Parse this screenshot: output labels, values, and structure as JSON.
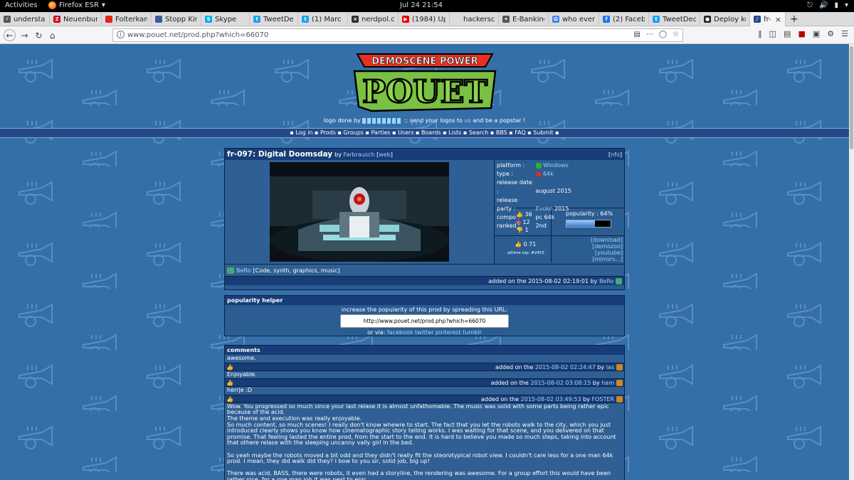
{
  "gnome": {
    "activities": "Activities",
    "app": "Firefox ESR",
    "clock": "Jul 24  21:54"
  },
  "tabs": [
    {
      "label": "understan",
      "color": "#555",
      "glyph": "⚡"
    },
    {
      "label": "Neuenburg",
      "color": "#d0021b",
      "glyph": "Z"
    },
    {
      "label": "Folterkam",
      "color": "#e1251b",
      "glyph": ""
    },
    {
      "label": "Stopp Kind",
      "color": "#3b5aa0",
      "glyph": ""
    },
    {
      "label": "Skype",
      "color": "#00aff0",
      "glyph": "S"
    },
    {
      "label": "TweetDec",
      "color": "#1da1f2",
      "glyph": "t"
    },
    {
      "label": "(1) Marc [L",
      "color": "#1da1f2",
      "glyph": "t"
    },
    {
      "label": "nerdpol.ch",
      "color": "#333",
      "glyph": "×"
    },
    {
      "label": "(1984) Upl",
      "color": "#e00",
      "glyph": "▶"
    },
    {
      "label": "hackerscardg",
      "color": "#ddd",
      "glyph": ""
    },
    {
      "label": "E-Banking",
      "color": "#555",
      "glyph": "✦"
    },
    {
      "label": "who ever s",
      "color": "#4285f4",
      "glyph": "G"
    },
    {
      "label": "(2) Facebo",
      "color": "#1877f2",
      "glyph": "f"
    },
    {
      "label": "TweetDec",
      "color": "#1da1f2",
      "glyph": "t"
    },
    {
      "label": "Deploy key",
      "color": "#222",
      "glyph": "●"
    },
    {
      "label": "fr-097:",
      "color": "#1e4a88",
      "glyph": "♪"
    }
  ],
  "url": "www.pouet.net/prod.php?which=66070",
  "logo": {
    "top": "DEMOSCENE POWER",
    "main": "POUET"
  },
  "logo_credit": {
    "before": "logo done by",
    "mid": ":: send your logos to",
    "us": "us",
    "after": "and be a popstar !"
  },
  "menu": "▪ Log in ▪ Prods ▪ Groups ▪ Parties ▪ Users ▪ Boards ▪ Lists ▪ Search ▪ BBS ▪ FAQ ▪ Submit ▪",
  "prod": {
    "title": "fr-097: Digital Doomsday",
    "by": "by",
    "group": "Farbrausch",
    "web": "web",
    "nfo": "nfo",
    "platform_k": "platform :",
    "platform": "Windows",
    "type_k": "type :",
    "type": "64k",
    "release_date_k": "release date :",
    "release_date": "august 2015",
    "party_k": "release party :",
    "party": "Evoke",
    "party_year": "2015",
    "compo_k": "compo :",
    "compo": "pc 64k",
    "ranked_k": "ranked :",
    "ranked": "2nd",
    "thumbs_up": "36",
    "piggie": "12",
    "thumbs_down": "1",
    "popularity_label": "popularity : 64%",
    "popularity": 64,
    "cdc": "0.71",
    "alltime": "alltime top: #2453",
    "links": [
      "[download]",
      "[demozoo]",
      "[youtube]",
      "[mirrors...]"
    ],
    "credit_user": "BeRo",
    "credit_role": "[Code, synth, graphics, music]",
    "added": "added on the 2015-08-02 02:19:01 by",
    "added_user": "BeRo"
  },
  "helper": {
    "header": "popularity helper",
    "line1": "increase the popularity of this prod by spreading this URL:",
    "url": "http://www.pouet.net/prod.php?which=66070",
    "via": "or via:",
    "via_links": "facebook twitter pinterest tumblr"
  },
  "comments": {
    "header": "comments",
    "items": [
      {
        "text": "awesome.",
        "added": "added on the",
        "date": "2015-08-02 02:24:47",
        "by": "by",
        "user": "las"
      },
      {
        "text": "Enjoyable.",
        "added": "added on the",
        "date": "2015-08-02 03:08:15",
        "by": "by",
        "user": "ham"
      },
      {
        "text": "herrje :D",
        "added": "added on the",
        "date": "2015-08-02 03:49:53",
        "by": "by",
        "user": "FOSTER"
      },
      {
        "text": "Wow. You progressed so much since your last relase it is almost unfathomable. The music was solid with some parts being rather epic because of the acid.\nThe theme and execution was really enjoyable.\nSo much content, so much scenes! I really don't know whewre to start. The fact that you let the robots walk to the city, which you just introduced clearly shows you know how cinematographic story telling works. I was waiting for that scene, and you delivered on that promise. That feeling lasted the entire prod, from the start to the end. It is hard to believe you made so much steps, taking into account that othere relase with the sleeping uncanny vally girl in the bed.\n\nSo yeah maybe the robots moved a bit odd and they didn't really fit the steorotypical robot view. I couldn't care less for a one man 64k prod. I mean, they did walk did they? I bow to you sir, solid job, big up!\n\nThere was acid, BASS, there were robots, it even had a storyline, the rendering was awesome. For a group effort this would have been rather nice, for a one man job it was next to epic."
      }
    ]
  }
}
